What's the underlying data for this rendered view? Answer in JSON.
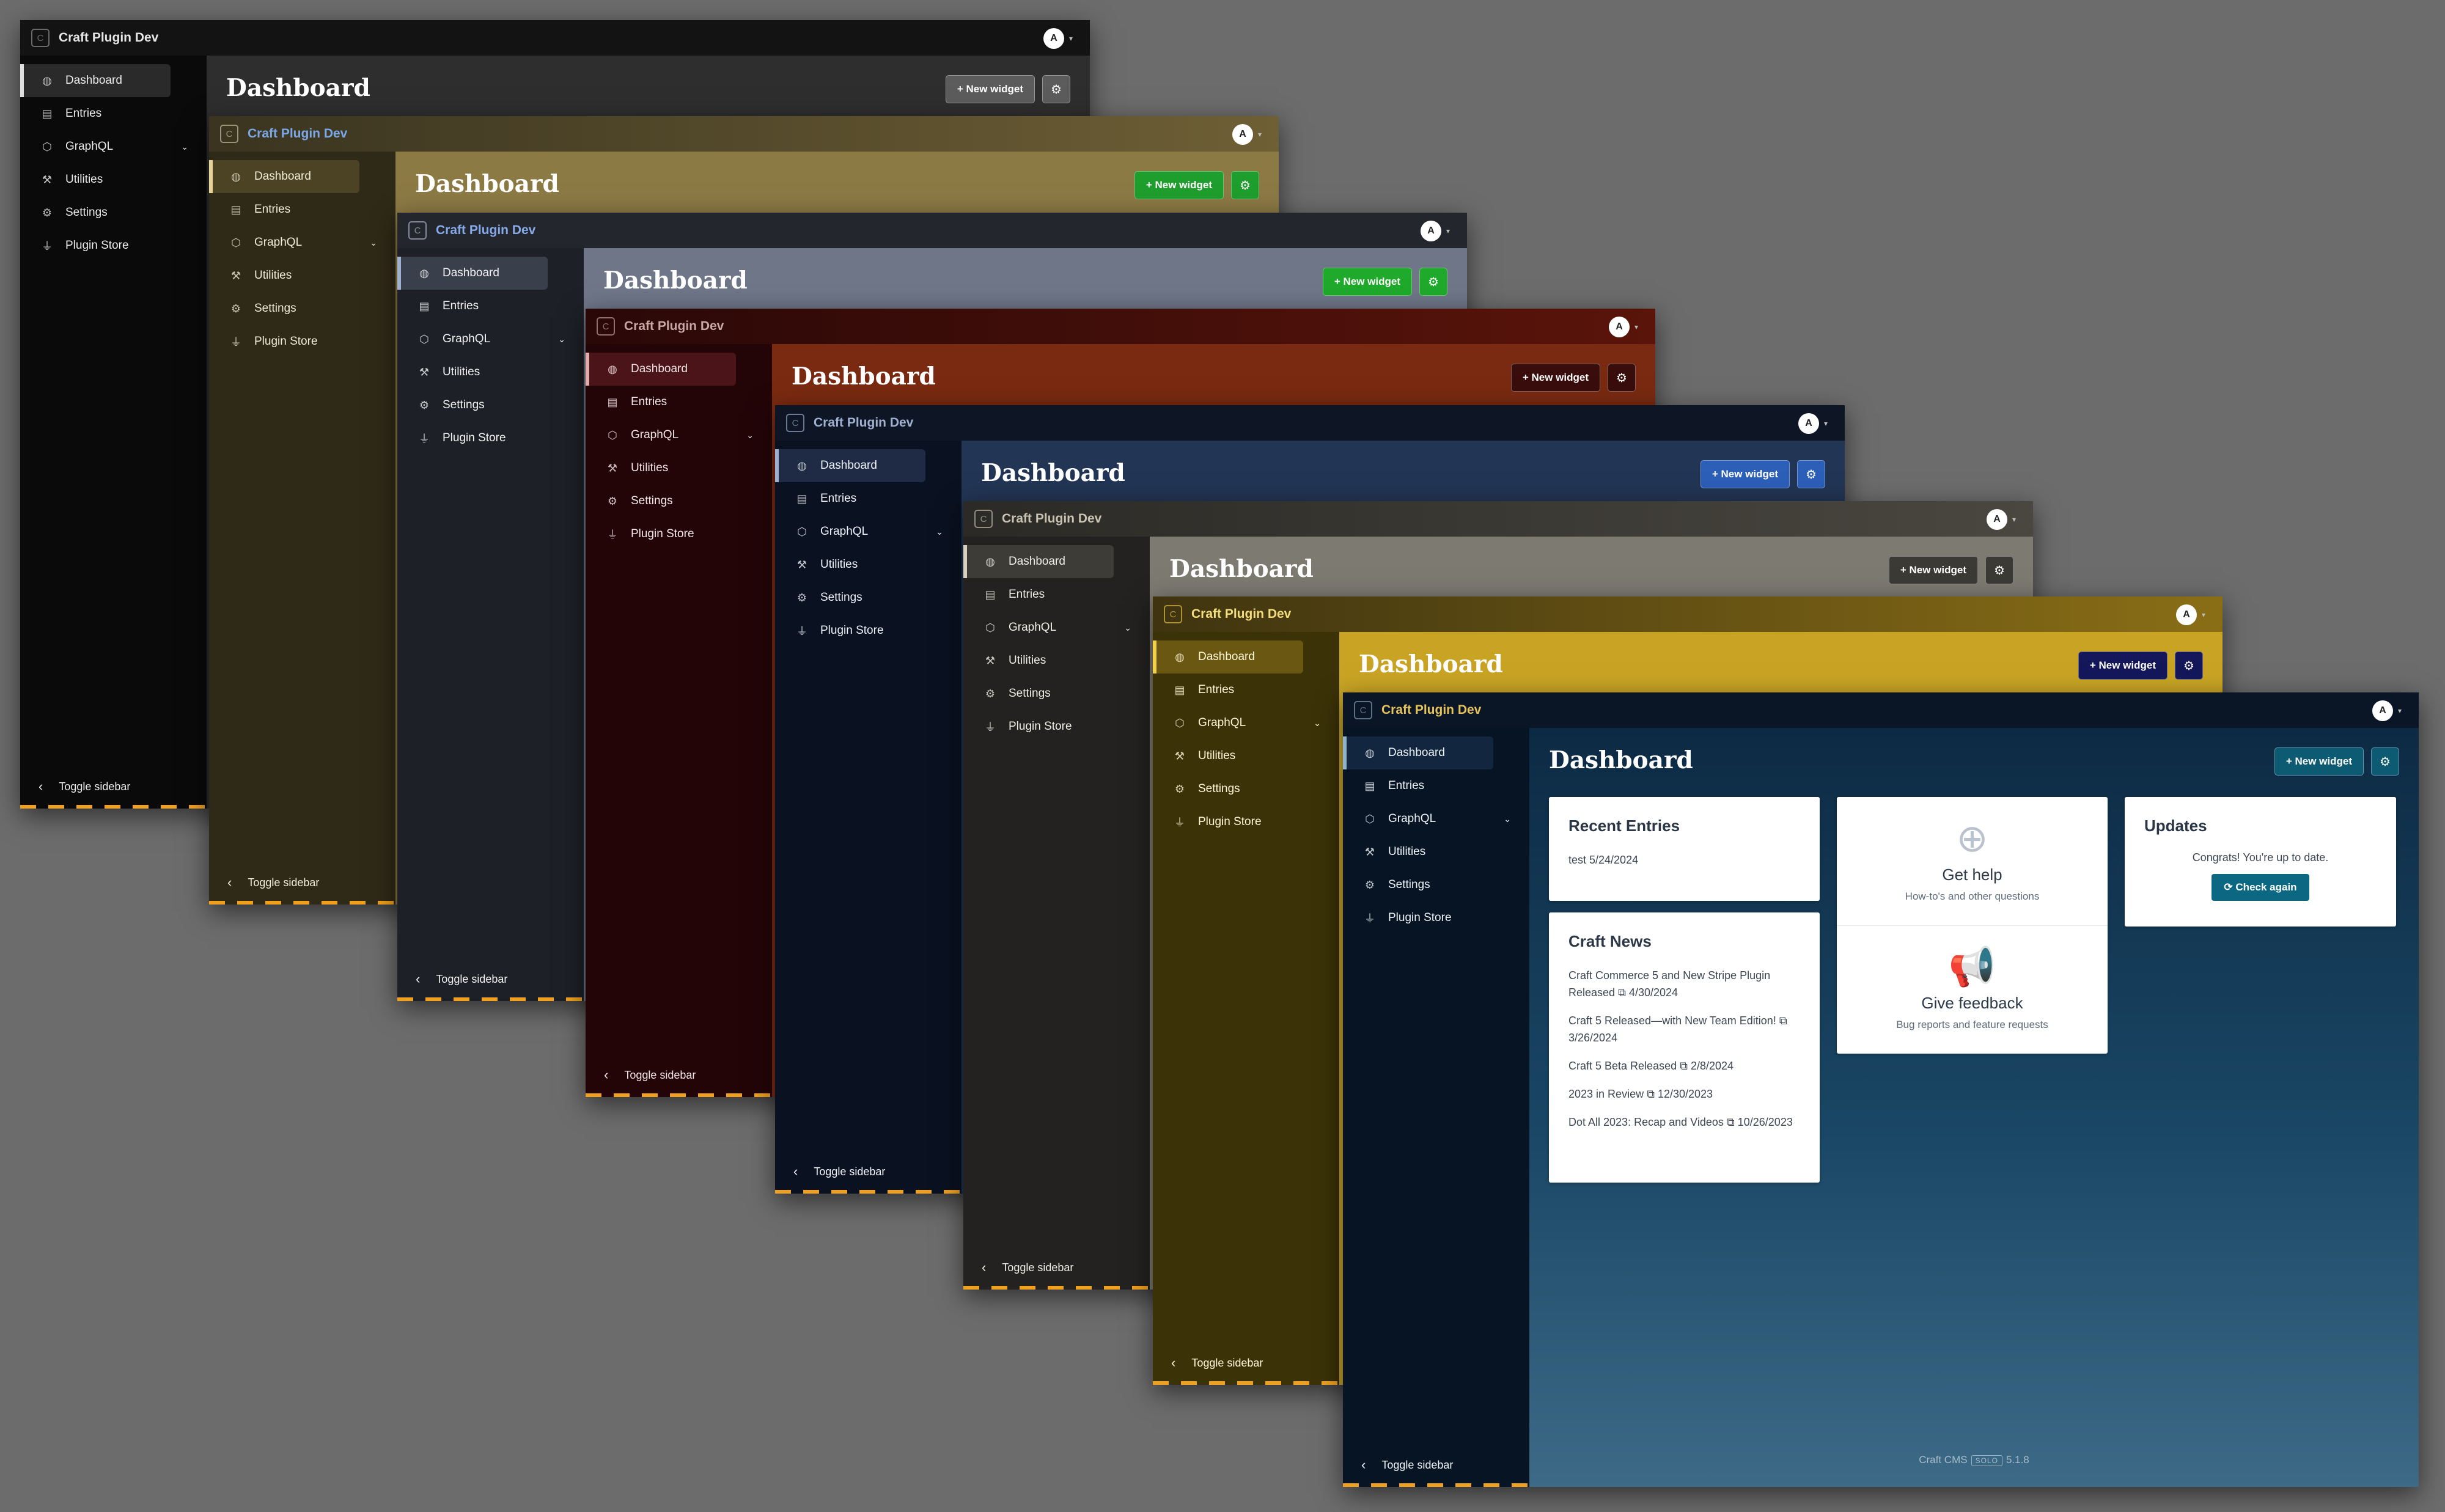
{
  "app": {
    "brand_letter": "C",
    "brand_name": "Craft Plugin Dev",
    "avatar_letter": "A"
  },
  "header": {
    "title": "Dashboard",
    "new_widget_label": "+ New widget",
    "settings_icon": "gear-icon"
  },
  "sidebar": {
    "items": [
      {
        "label": "Dashboard",
        "icon": "gauge-icon"
      },
      {
        "label": "Entries",
        "icon": "entries-icon"
      },
      {
        "label": "GraphQL",
        "icon": "graphql-icon"
      },
      {
        "label": "Utilities",
        "icon": "wrench-icon"
      },
      {
        "label": "Settings",
        "icon": "gear-icon"
      },
      {
        "label": "Plugin Store",
        "icon": "plug-icon"
      }
    ],
    "toggle_label": "Toggle sidebar"
  },
  "widgets": {
    "recent": {
      "title": "Recent Entries",
      "entry": "test 5/24/2024"
    },
    "news": {
      "title": "Craft News",
      "items": [
        {
          "title": "Craft Commerce 5 and New Stripe Plugin Released",
          "date": "4/30/2024"
        },
        {
          "title": "Craft 5 Released—with New Team Edition!",
          "date": "3/26/2024"
        },
        {
          "title": "Craft 5 Beta Released",
          "date": "2/8/2024"
        },
        {
          "title": "2023 in Review",
          "date": "12/30/2023"
        },
        {
          "title": "Dot All 2023: Recap and Videos",
          "date": "10/26/2023"
        }
      ]
    },
    "help": {
      "get_help_title": "Get help",
      "get_help_sub": "How-to's and other questions",
      "feedback_title": "Give feedback",
      "feedback_sub": "Bug reports and feature requests"
    },
    "updates": {
      "title": "Updates",
      "message": "Congrats! You're up to date.",
      "button": "Check again"
    }
  },
  "footer": {
    "product": "Craft CMS",
    "edition": "SOLO",
    "version": "5.1.8"
  }
}
